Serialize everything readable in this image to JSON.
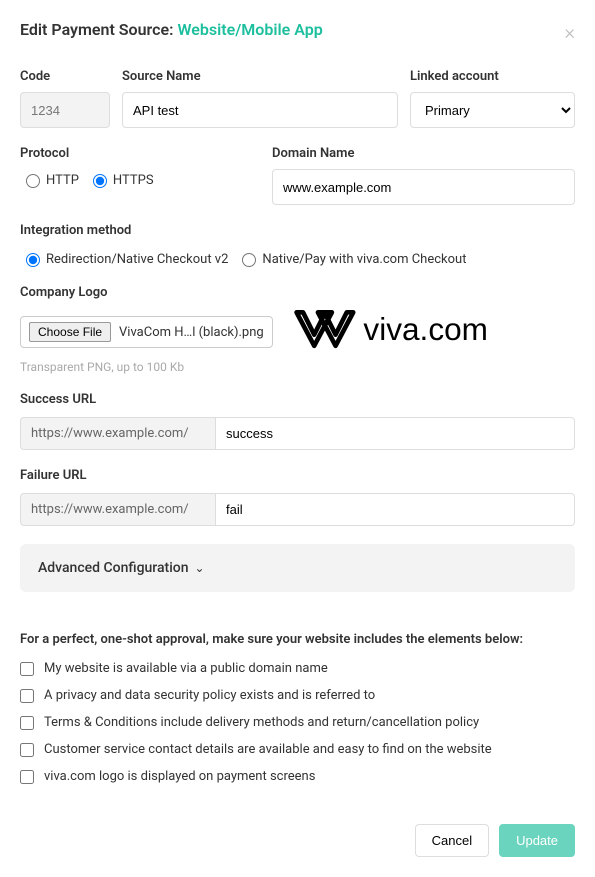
{
  "header": {
    "title_prefix": "Edit Payment Source: ",
    "title_accent": "Website/Mobile App"
  },
  "fields": {
    "code": {
      "label": "Code",
      "value": "1234"
    },
    "source_name": {
      "label": "Source Name",
      "value": "API test"
    },
    "linked_account": {
      "label": "Linked account",
      "value": "Primary"
    },
    "protocol": {
      "label": "Protocol",
      "http": "HTTP",
      "https": "HTTPS",
      "selected": "https"
    },
    "domain_name": {
      "label": "Domain Name",
      "value": "www.example.com"
    },
    "integration": {
      "label": "Integration method",
      "opt1": "Redirection/Native Checkout v2",
      "opt2": "Native/Pay with viva.com Checkout",
      "selected": "opt1"
    },
    "company_logo": {
      "label": "Company Logo",
      "button": "Choose File",
      "filename": "VivaCom H…l (black).png",
      "hint": "Transparent PNG, up to 100 Kb"
    },
    "success_url": {
      "label": "Success URL",
      "prefix": "https://www.example.com/",
      "value": "success"
    },
    "failure_url": {
      "label": "Failure URL",
      "prefix": "https://www.example.com/",
      "value": "fail"
    },
    "advanced": "Advanced Configuration"
  },
  "checklist": {
    "heading": "For a perfect, one-shot approval, make sure your website includes the elements below:",
    "items": [
      "My website is available via a public domain name",
      "A privacy and data security policy exists and is referred to",
      "Terms & Conditions include delivery methods and return/cancellation policy",
      "Customer service contact details are available and easy to find on the website",
      "viva.com logo is displayed on payment screens"
    ]
  },
  "footer": {
    "cancel": "Cancel",
    "update": "Update"
  }
}
